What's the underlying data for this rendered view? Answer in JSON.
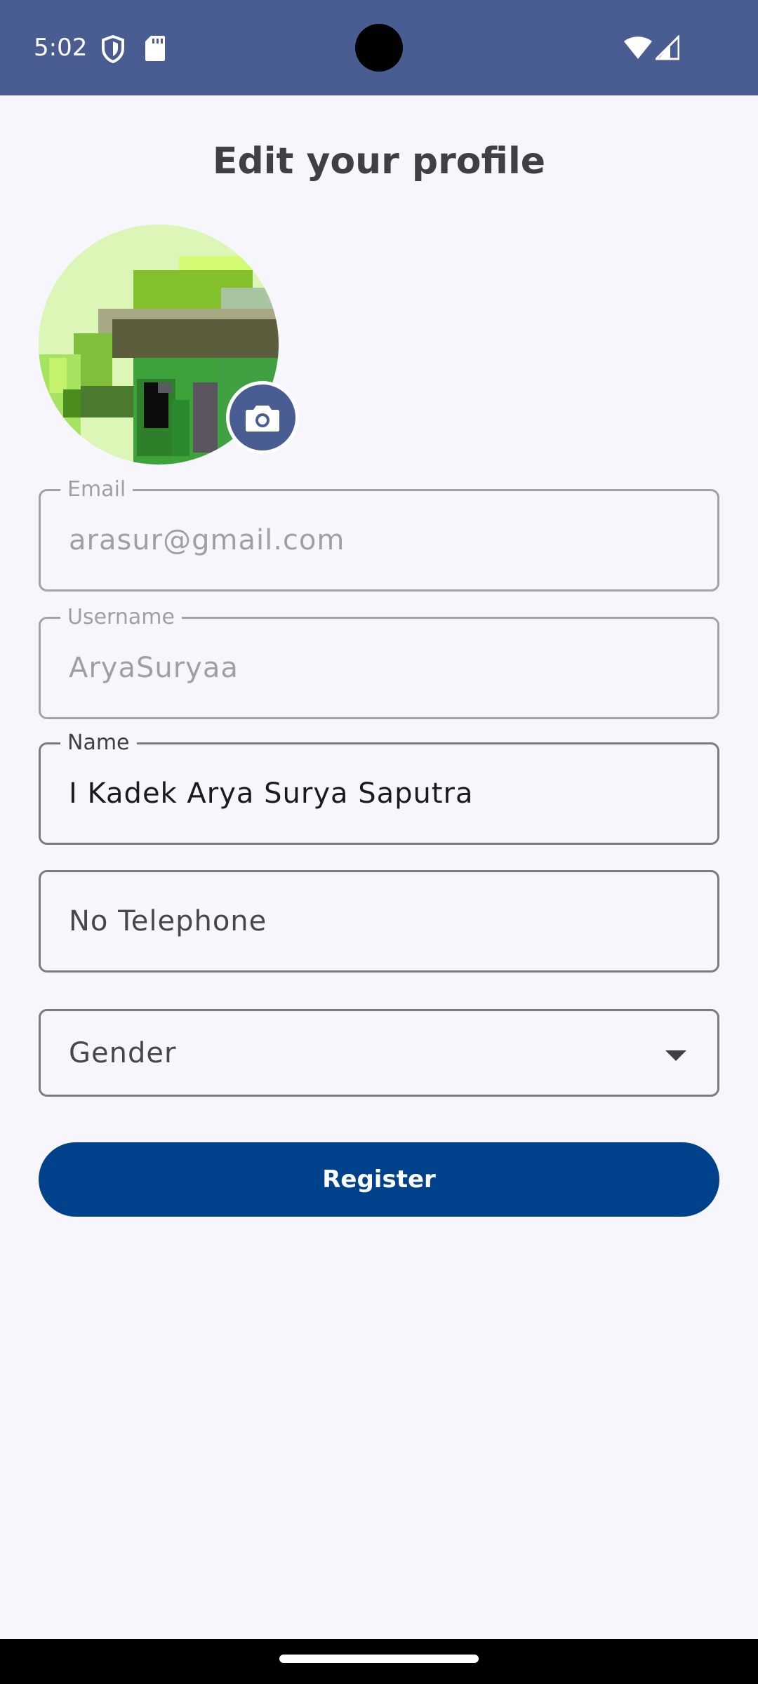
{
  "status_bar": {
    "time": "5:02",
    "icons": [
      "shield-icon",
      "sd-card-icon",
      "wifi-icon",
      "signal-icon"
    ]
  },
  "header": {
    "title": "Edit your profile"
  },
  "avatar": {
    "icon": "camera-icon"
  },
  "form": {
    "email": {
      "label": "Email",
      "value": "arasur@gmail.com"
    },
    "username": {
      "label": "Username",
      "value": "AryaSuryaa"
    },
    "name": {
      "label": "Name",
      "value": "I Kadek Arya Surya Saputra"
    },
    "telephone": {
      "placeholder": "No Telephone"
    },
    "gender": {
      "placeholder": "Gender",
      "icon": "dropdown-arrow-icon"
    }
  },
  "actions": {
    "register_label": "Register"
  },
  "colors": {
    "status_bar": "#495d93",
    "background": "#f7f6fc",
    "primary_button": "#00418b",
    "camera_button": "#4a5d92"
  }
}
